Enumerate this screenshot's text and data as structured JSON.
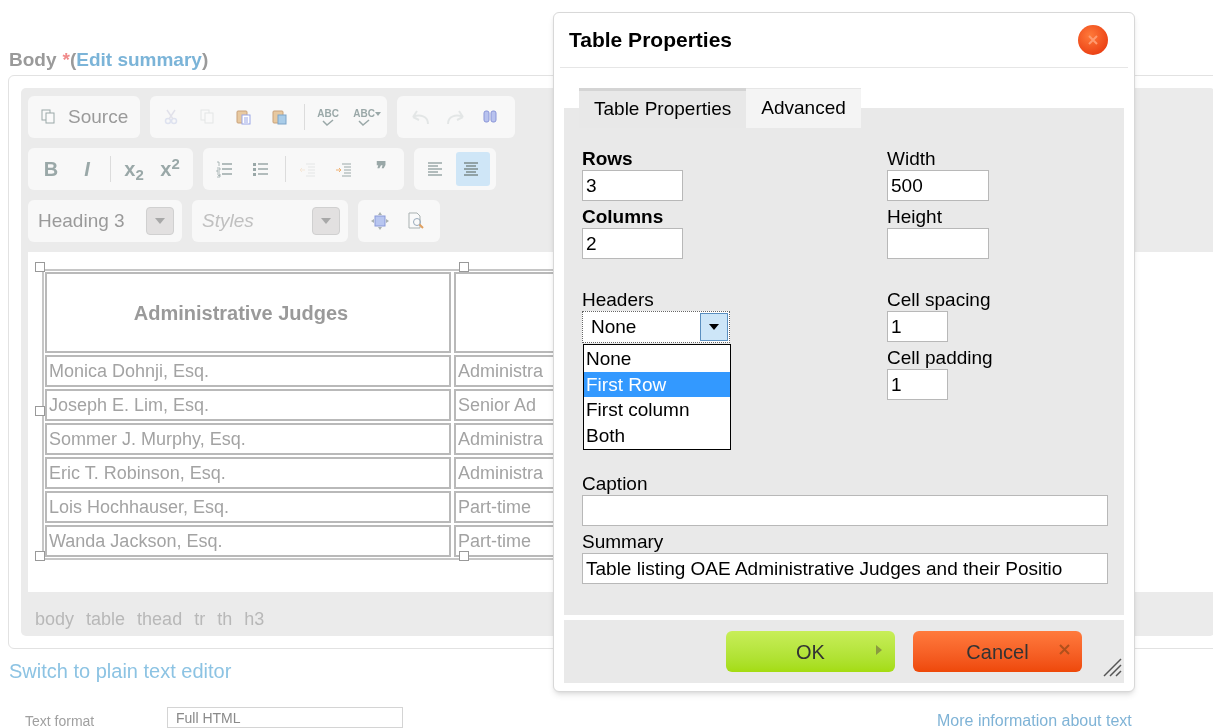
{
  "field_label": {
    "label": "Body",
    "required_mark": "*",
    "open_paren": "(",
    "link": "Edit summary",
    "close_paren": ")"
  },
  "toolbar": [
    [
      [
        {
          "kind": "source",
          "label": "Source",
          "disabled": false
        }
      ],
      [
        {
          "kind": "cut",
          "disabled": true
        },
        {
          "kind": "copy",
          "disabled": true
        },
        {
          "kind": "paste",
          "disabled": false
        },
        {
          "kind": "paste-word",
          "disabled": false
        },
        {
          "kind": "sep"
        },
        {
          "kind": "spellcheck",
          "label": "ABC",
          "disabled": false
        },
        {
          "kind": "spellcheck-menu",
          "label": "ABC",
          "disabled": false
        }
      ],
      [
        {
          "kind": "undo",
          "disabled": true
        },
        {
          "kind": "redo",
          "disabled": true
        },
        {
          "kind": "find",
          "disabled": false
        }
      ]
    ],
    [
      [
        {
          "kind": "bold",
          "label": "B",
          "disabled": false
        },
        {
          "kind": "italic",
          "label": "I",
          "disabled": false
        },
        {
          "kind": "sep"
        },
        {
          "kind": "subscript",
          "label": "x$_{2}$",
          "disabled": false
        },
        {
          "kind": "superscript",
          "label": "x$^{2}$",
          "disabled": false
        }
      ],
      [
        {
          "kind": "numbered-list",
          "disabled": false
        },
        {
          "kind": "bullet-list",
          "disabled": false
        },
        {
          "kind": "sep"
        },
        {
          "kind": "outdent",
          "disabled": true
        },
        {
          "kind": "indent",
          "disabled": false
        },
        {
          "kind": "quote",
          "label": "❞",
          "disabled": false
        }
      ],
      [
        {
          "kind": "align-left",
          "disabled": false,
          "selected": false
        },
        {
          "kind": "align-center",
          "disabled": false,
          "selected": true
        }
      ]
    ]
  ],
  "combos": [
    {
      "value": "Heading 3",
      "placeholder": false
    },
    {
      "value": "Styles",
      "placeholder": true
    }
  ],
  "combo_tools": [
    {
      "kind": "maximize"
    },
    {
      "kind": "show-blocks"
    }
  ],
  "table": {
    "header": [
      "Administrative Judges"
    ],
    "rows": [
      [
        "Monica Dohnji, Esq.",
        "Administra"
      ],
      [
        "Joseph E. Lim, Esq.",
        "Senior Ad"
      ],
      [
        "Sommer J. Murphy, Esq.",
        "Administra"
      ],
      [
        "Eric T. Robinson, Esq.",
        "Administra"
      ],
      [
        "Lois Hochhauser, Esq.",
        "Part-time"
      ],
      [
        "Wanda Jackson, Esq.",
        "Part-time"
      ]
    ]
  },
  "element_path": [
    "body",
    "table",
    "thead",
    "tr",
    "th",
    "h3"
  ],
  "switch_link": "Switch to plain text editor",
  "text_format": {
    "label": "Text format",
    "value": "Full HTML",
    "help_link": "More information about text"
  },
  "dialog": {
    "title": "Table Properties",
    "tabs": [
      {
        "label": "Table Properties",
        "selected": true
      },
      {
        "label": "Advanced",
        "selected": false
      }
    ],
    "left_fields": [
      {
        "label": "Rows",
        "value": "3",
        "required": true
      },
      {
        "label": "Columns",
        "value": "2",
        "required": true
      }
    ],
    "right_fields": [
      {
        "label": "Width",
        "value": "500",
        "required": false
      },
      {
        "label": "Height",
        "required": false
      }
    ],
    "headers": {
      "label": "Headers",
      "value": "None",
      "expanded": true,
      "options": [
        {
          "label": "None",
          "highlighted": false
        },
        {
          "label": "First Row",
          "highlighted": true
        },
        {
          "label": "First column",
          "highlighted": false
        },
        {
          "label": "Both",
          "highlighted": false
        }
      ]
    },
    "spacing_fields": [
      {
        "label": "Cell spacing",
        "value": "1"
      },
      {
        "label": "Cell padding",
        "value": "1"
      }
    ],
    "caption": {
      "label": "Caption"
    },
    "summary": {
      "label": "Summary",
      "value": "Table listing OAE Administrative Judges and their Positio"
    },
    "buttons": [
      {
        "label": "OK",
        "kind": "ok"
      },
      {
        "label": "Cancel",
        "kind": "cancel"
      }
    ]
  }
}
